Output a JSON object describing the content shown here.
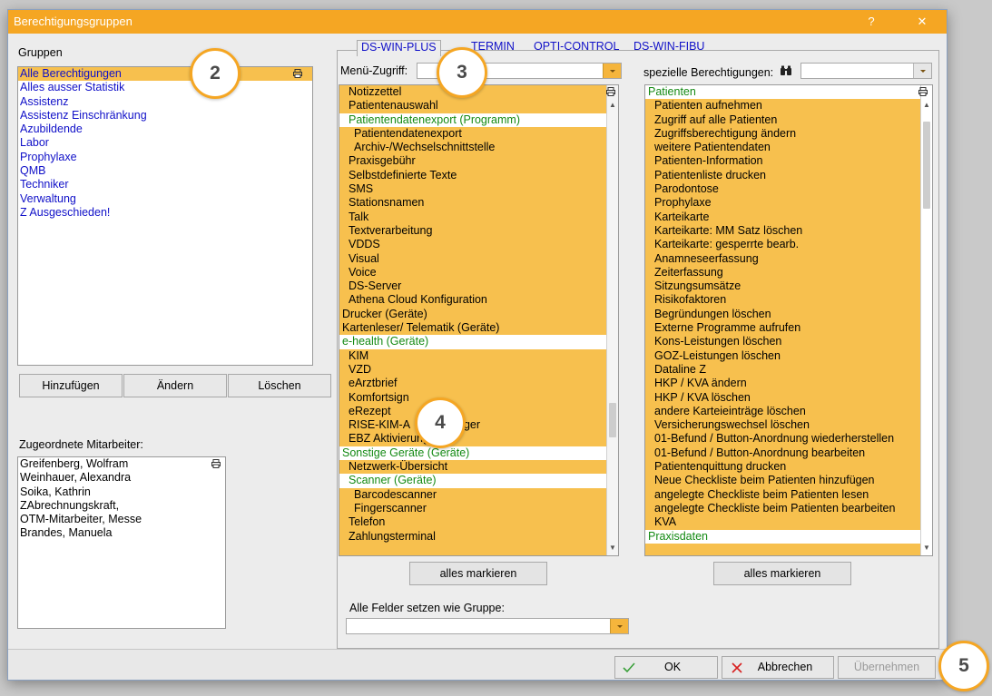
{
  "window": {
    "title": "Berechtigungsgruppen",
    "help_label": "?",
    "close_label": "✕"
  },
  "groups": {
    "heading": "Gruppen",
    "items": [
      "Alle Berechtigungen",
      "Alles ausser Statistik",
      "Assistenz",
      "Assistenz Einschränkung",
      "Azubildende",
      "Labor",
      "Prophylaxe",
      "QMB",
      "Techniker",
      "Verwaltung",
      "Z Ausgeschieden!"
    ],
    "selected_index": 0
  },
  "group_buttons": {
    "add": "Hinzufügen",
    "edit": "Ändern",
    "delete": "Löschen"
  },
  "employees": {
    "heading": "Zugeordnete Mitarbeiter:",
    "items": [
      "Greifenberg, Wolfram",
      "Weinhauer, Alexandra",
      "Soika, Kathrin",
      "ZAbrechnungskraft,",
      "OTM-Mitarbeiter, Messe",
      "Brandes, Manuela"
    ]
  },
  "tabs": {
    "dswin_plus": "DS-WIN-PLUS",
    "termin": "TERMIN",
    "opti_control": "OPTI-CONTROL",
    "dswin_fibu": "DS-WIN-FIBU"
  },
  "menu_access": {
    "label": "Menü-Zugriff:",
    "value": "",
    "items": [
      {
        "text": "Notizzettel",
        "indent": 1,
        "style": "normal"
      },
      {
        "text": "Patientenauswahl",
        "indent": 1,
        "style": "normal"
      },
      {
        "text": "Patientendatenexport (Programm)",
        "indent": 1,
        "style": "white"
      },
      {
        "text": "Patientendatenexport",
        "indent": 2,
        "style": "normal"
      },
      {
        "text": "Archiv-/Wechselschnittstelle",
        "indent": 2,
        "style": "normal"
      },
      {
        "text": "Praxisgebühr",
        "indent": 1,
        "style": "normal"
      },
      {
        "text": "Selbstdefinierte Texte",
        "indent": 1,
        "style": "normal"
      },
      {
        "text": "SMS",
        "indent": 1,
        "style": "normal"
      },
      {
        "text": "Stationsnamen",
        "indent": 1,
        "style": "normal"
      },
      {
        "text": "Talk",
        "indent": 1,
        "style": "normal"
      },
      {
        "text": "Textverarbeitung",
        "indent": 1,
        "style": "normal"
      },
      {
        "text": "VDDS",
        "indent": 1,
        "style": "normal"
      },
      {
        "text": "Visual",
        "indent": 1,
        "style": "normal"
      },
      {
        "text": "Voice",
        "indent": 1,
        "style": "normal"
      },
      {
        "text": "DS-Server",
        "indent": 1,
        "style": "normal"
      },
      {
        "text": "Athena Cloud Konfiguration",
        "indent": 1,
        "style": "normal"
      },
      {
        "text": "Drucker (Geräte)",
        "indent": 0,
        "style": "normal"
      },
      {
        "text": "Kartenleser/ Telematik (Geräte)",
        "indent": 0,
        "style": "normal"
      },
      {
        "text": "e-health (Geräte)",
        "indent": 0,
        "style": "white"
      },
      {
        "text": "KIM",
        "indent": 1,
        "style": "normal"
      },
      {
        "text": "VZD",
        "indent": 1,
        "style": "normal"
      },
      {
        "text": "eArztbrief",
        "indent": 1,
        "style": "normal"
      },
      {
        "text": "Komfortsign",
        "indent": 1,
        "style": "normal"
      },
      {
        "text": "eRezept",
        "indent": 1,
        "style": "normal"
      },
      {
        "text": "RISE-KIM-A",
        "suffix": "nager",
        "indent": 1,
        "style": "normal"
      },
      {
        "text": "EBZ Aktivierung",
        "indent": 1,
        "style": "normal"
      },
      {
        "text": "Sonstige Geräte (Geräte)",
        "indent": 0,
        "style": "white"
      },
      {
        "text": "Netzwerk-Übersicht",
        "indent": 1,
        "style": "normal"
      },
      {
        "text": "Scanner (Geräte)",
        "indent": 1,
        "style": "white"
      },
      {
        "text": "Barcodescanner",
        "indent": 2,
        "style": "normal"
      },
      {
        "text": "Fingerscanner",
        "indent": 2,
        "style": "normal"
      },
      {
        "text": "Telefon",
        "indent": 1,
        "style": "normal"
      },
      {
        "text": "Zahlungsterminal",
        "indent": 1,
        "style": "normal"
      }
    ],
    "mark_all": "alles markieren"
  },
  "special": {
    "label": "spezielle Berechtigungen:",
    "search_icon": "binoculars-icon",
    "items": [
      {
        "text": "Patienten",
        "style": "white"
      },
      {
        "text": "Patienten aufnehmen",
        "style": "normal"
      },
      {
        "text": "Zugriff auf alle Patienten",
        "style": "normal"
      },
      {
        "text": "Zugriffsberechtigung ändern",
        "style": "normal"
      },
      {
        "text": "weitere Patientendaten",
        "style": "normal"
      },
      {
        "text": "Patienten-Information",
        "style": "normal"
      },
      {
        "text": "Patientenliste drucken",
        "style": "normal"
      },
      {
        "text": "Parodontose",
        "style": "normal"
      },
      {
        "text": "Prophylaxe",
        "style": "normal"
      },
      {
        "text": "Karteikarte",
        "style": "normal"
      },
      {
        "text": "Karteikarte: MM Satz löschen",
        "style": "normal"
      },
      {
        "text": "Karteikarte: gesperrte bearb.",
        "style": "normal"
      },
      {
        "text": "Anamneseerfassung",
        "style": "normal"
      },
      {
        "text": "Zeiterfassung",
        "style": "normal"
      },
      {
        "text": "Sitzungsumsätze",
        "style": "normal"
      },
      {
        "text": "Risikofaktoren",
        "style": "normal"
      },
      {
        "text": "Begründungen löschen",
        "style": "normal"
      },
      {
        "text": "Externe Programme aufrufen",
        "style": "normal"
      },
      {
        "text": "Kons-Leistungen löschen",
        "style": "normal"
      },
      {
        "text": "GOZ-Leistungen löschen",
        "style": "normal"
      },
      {
        "text": "Dataline Z",
        "style": "normal"
      },
      {
        "text": "HKP / KVA ändern",
        "style": "normal"
      },
      {
        "text": "HKP / KVA löschen",
        "style": "normal"
      },
      {
        "text": "andere Karteieinträge löschen",
        "style": "normal"
      },
      {
        "text": "Versicherungswechsel löschen",
        "style": "normal"
      },
      {
        "text": "01-Befund / Button-Anordnung wiederherstellen",
        "style": "normal"
      },
      {
        "text": "01-Befund / Button-Anordnung bearbeiten",
        "style": "normal"
      },
      {
        "text": "Patientenquittung drucken",
        "style": "normal"
      },
      {
        "text": "Neue Checkliste beim Patienten hinzufügen",
        "style": "normal"
      },
      {
        "text": "angelegte Checkliste beim Patienten lesen",
        "style": "normal"
      },
      {
        "text": "angelegte Checkliste beim Patienten bearbeiten",
        "style": "normal"
      },
      {
        "text": "KVA",
        "style": "normal"
      },
      {
        "text": "Praxisdaten",
        "style": "white"
      }
    ],
    "mark_all": "alles markieren"
  },
  "copy_group": {
    "label": "Alle Felder setzen wie Gruppe:",
    "value": ""
  },
  "footer": {
    "ok": "OK",
    "cancel": "Abbrechen",
    "apply": "Übernehmen"
  },
  "callouts": [
    "2",
    "3",
    "4",
    "5"
  ],
  "colors": {
    "accent": "#f5a623",
    "selection": "#f7c04e",
    "link_blue": "#1010c8",
    "category_green": "#148a14"
  }
}
